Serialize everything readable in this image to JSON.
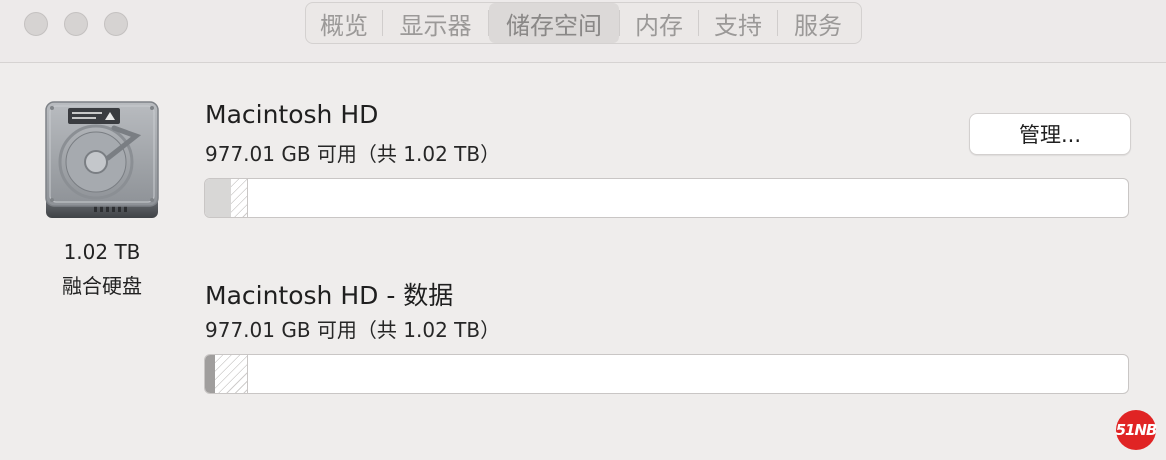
{
  "tabs": [
    {
      "label": "概览"
    },
    {
      "label": "显示器"
    },
    {
      "label": "储存空间",
      "active": true
    },
    {
      "label": "内存"
    },
    {
      "label": "支持"
    },
    {
      "label": "服务"
    }
  ],
  "disk": {
    "capacity": "1.02 TB",
    "type": "融合硬盘"
  },
  "volumes": [
    {
      "name": "Macintosh HD",
      "available": "977.01 GB 可用（共 1.02 TB）",
      "used_fraction": 0.028,
      "purgeable_fraction": 0.017
    },
    {
      "name": "Macintosh HD - 数据",
      "available": "977.01 GB 可用（共 1.02 TB）",
      "used_fraction": 0.011,
      "purgeable_fraction": 0.034
    }
  ],
  "manage_button": "管理...",
  "watermark": "51NB",
  "colors": {
    "used_system": "#d8d7d6",
    "used_data": "#a09e9d",
    "purgeable_stripe": "#cfcdcc",
    "watermark": "#e02424"
  }
}
